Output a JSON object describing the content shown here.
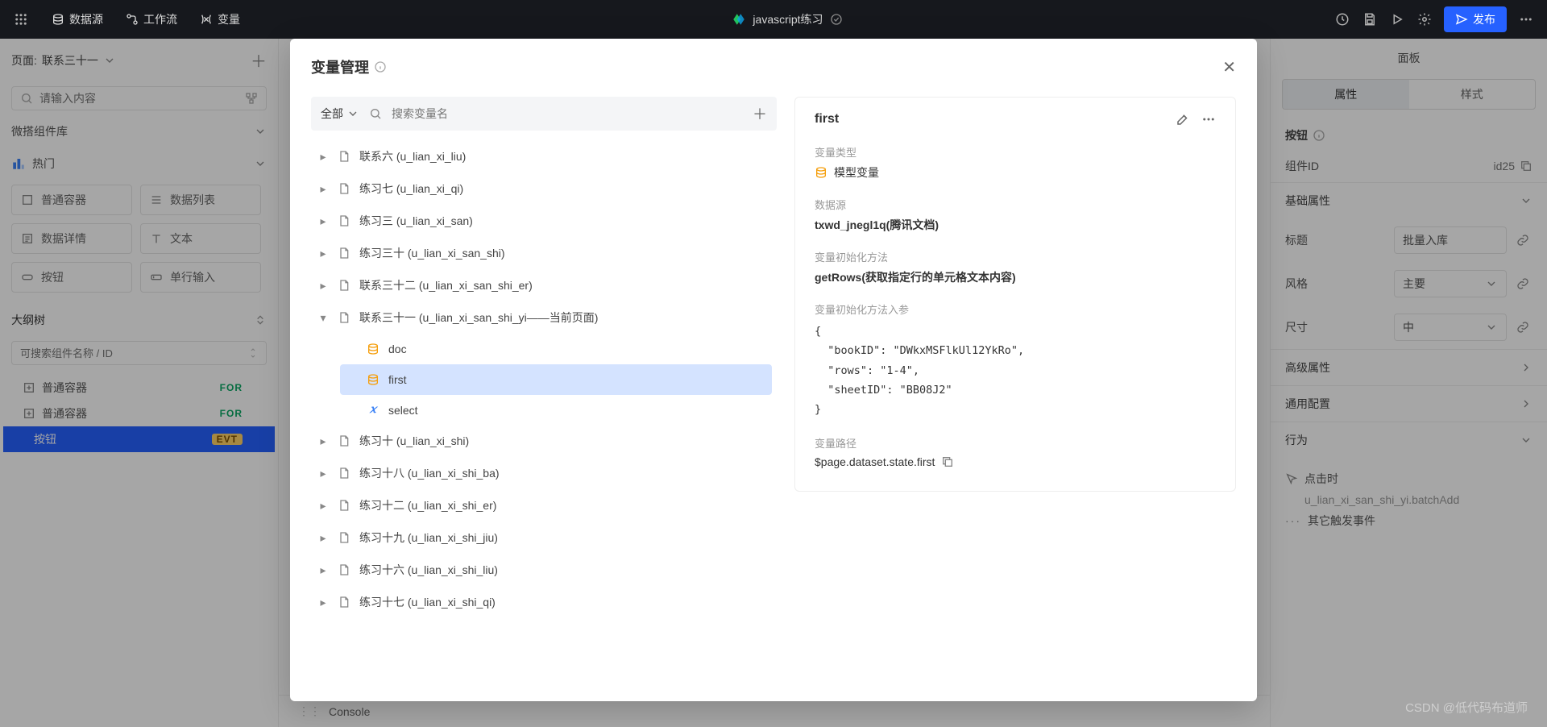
{
  "topbar": {
    "menu": {
      "data_source": "数据源",
      "workflow": "工作流",
      "variable": "变量"
    },
    "project": "javascript练习",
    "publish": "发布"
  },
  "leftPanel": {
    "page_label": "页面:",
    "page_name": "联系三十一",
    "search_placeholder": "请输入内容",
    "widgets_header": "微搭组件库",
    "hot": "热门",
    "chips": [
      "普通容器",
      "数据列表",
      "数据详情",
      "文本",
      "按钮",
      "单行输入"
    ],
    "tree_header": "大纲树",
    "tree_search_placeholder": "可搜索组件名称 / ID",
    "tree": [
      {
        "label": "普通容器",
        "badge": "FOR"
      },
      {
        "label": "普通容器",
        "badge": "FOR"
      },
      {
        "label": "按钮",
        "badge": "EVT",
        "selected": true
      }
    ]
  },
  "rightPanel": {
    "title": "面板",
    "tabs": {
      "props": "属性",
      "style": "样式"
    },
    "section_button": "按钮",
    "comp_id_label": "组件ID",
    "comp_id_value": "id25",
    "basic_props": "基础属性",
    "rows": {
      "title_label": "标题",
      "title_value": "批量入库",
      "style_label": "风格",
      "style_value": "主要",
      "size_label": "尺寸",
      "size_value": "中"
    },
    "advanced": "高级属性",
    "general": "通用配置",
    "behavior": "行为",
    "behavior_items": {
      "on_click": "点击时",
      "action": "u_lian_xi_san_shi_yi.batchAdd",
      "other": "其它触发事件"
    }
  },
  "console": "Console",
  "modal": {
    "title": "变量管理",
    "filter_all": "全部",
    "search_placeholder": "搜索变量名",
    "items": [
      {
        "label": "联系六 (u_lian_xi_liu)"
      },
      {
        "label": "练习七 (u_lian_xi_qi)"
      },
      {
        "label": "练习三 (u_lian_xi_san)"
      },
      {
        "label": "练习三十 (u_lian_xi_san_shi)"
      },
      {
        "label": "联系三十二 (u_lian_xi_san_shi_er)"
      },
      {
        "label": "联系三十一 (u_lian_xi_san_shi_yi——当前页面)",
        "expanded": true,
        "children": [
          {
            "label": "doc",
            "kind": "db"
          },
          {
            "label": "first",
            "kind": "db",
            "active": true
          },
          {
            "label": "select",
            "kind": "x"
          }
        ]
      },
      {
        "label": "练习十 (u_lian_xi_shi)"
      },
      {
        "label": "练习十八 (u_lian_xi_shi_ba)"
      },
      {
        "label": "练习十二 (u_lian_xi_shi_er)"
      },
      {
        "label": "练习十九 (u_lian_xi_shi_jiu)"
      },
      {
        "label": "练习十六 (u_lian_xi_shi_liu)"
      },
      {
        "label": "练习十七 (u_lian_xi_shi_qi)"
      }
    ],
    "detail": {
      "name": "first",
      "type_label": "变量类型",
      "type_value": "模型变量",
      "ds_label": "数据源",
      "ds_value": "txwd_jnegl1q(腾讯文档)",
      "init_label": "变量初始化方法",
      "init_value": "getRows(获取指定行的单元格文本内容)",
      "args_label": "变量初始化方法入参",
      "args_code": "{\n  \"bookID\": \"DWkxMSFlkUl12YkRo\",\n  \"rows\": \"1-4\",\n  \"sheetID\": \"BB08J2\"\n}",
      "path_label": "变量路径",
      "path_value": "$page.dataset.state.first"
    }
  },
  "watermark": "CSDN @低代码布道师"
}
